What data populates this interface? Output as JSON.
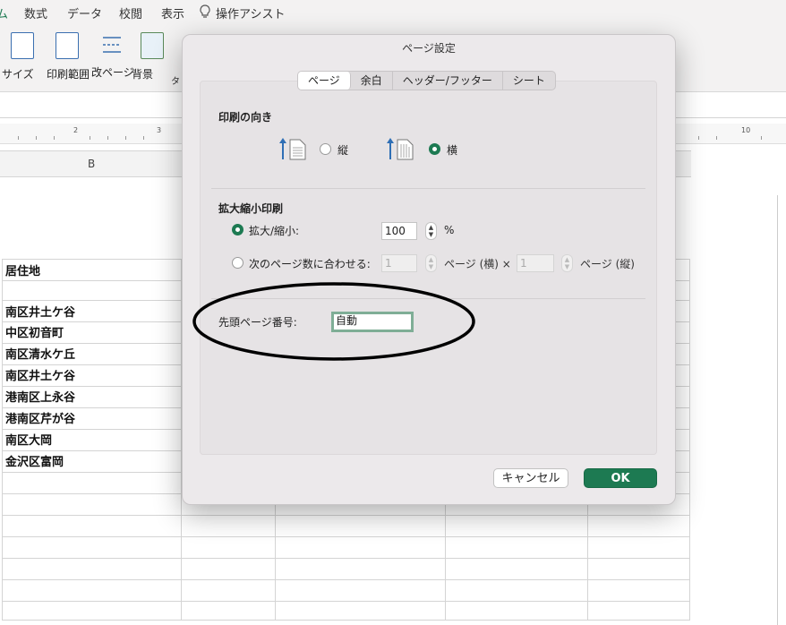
{
  "excel": {
    "menu": [
      "数式",
      "データ",
      "校閲",
      "表示",
      "操作アシスト"
    ],
    "ribbon_buttons": [
      "サイズ",
      "印刷範囲",
      "改ページ",
      "背景"
    ],
    "ribbon_partial": "タ",
    "ruler_numbers": [
      "2",
      "3",
      "10"
    ],
    "column_header": "B",
    "cells": [
      "居住地",
      "",
      "南区井土ケ谷",
      "中区初音町",
      "南区清水ケ丘",
      "南区井土ケ谷",
      "港南区上永谷",
      "港南区芹が谷",
      "南区大岡",
      "金沢区富岡"
    ]
  },
  "dialog": {
    "title": "ページ設定",
    "tabs": [
      "ページ",
      "余白",
      "ヘッダー/フッター",
      "シート"
    ],
    "active_tab": "ページ",
    "orientation": {
      "heading": "印刷の向き",
      "portrait_label": "縦",
      "landscape_label": "横",
      "selected": "横"
    },
    "scaling": {
      "heading": "拡大縮小印刷",
      "zoom_label": "拡大/縮小:",
      "zoom_value": "100",
      "percent": "%",
      "fit_label": "次のページ数に合わせる:",
      "fit_wide_value": "1",
      "fit_wide_label": "ページ (横) ×",
      "fit_tall_value": "1",
      "fit_tall_label": "ページ (縦)",
      "selected": "zoom"
    },
    "first_page": {
      "label": "先頭ページ番号:",
      "value": "自動"
    },
    "buttons": {
      "cancel": "キャンセル",
      "ok": "OK"
    },
    "colors": {
      "accent": "#1d7a52",
      "focus_ring": "#7fae96",
      "annotation": "#000000"
    }
  }
}
